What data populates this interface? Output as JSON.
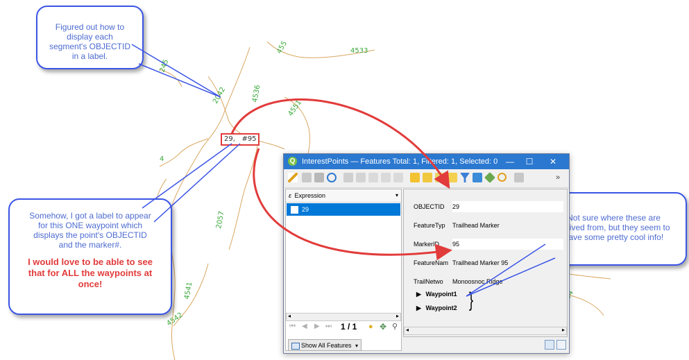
{
  "callouts": {
    "top": "Figured out how to display each segment's OBJECTID in a label.",
    "left_main": "Somehow, I got a label to appear for this ONE waypoint which displays the point's OBJECTID and the marker#.",
    "left_red": "I would love to be able to see that for ALL the waypoints at once!",
    "right": "Not sure where these are derived from, but they seem to have some pretty cool info!"
  },
  "map": {
    "waypoint_label": "29,   #95",
    "segment_labels": [
      "2042",
      "4536",
      "4551",
      "2057",
      "4541",
      "4542",
      "4533",
      "455",
      "245",
      "4",
      "94"
    ],
    "colors": {
      "trail": "#d9a760",
      "label": "#3aa83a",
      "annotation": "#e23b3b",
      "callout_border": "#3b55e6"
    }
  },
  "window": {
    "title": "InterestPoints — Features Total: 1, Filtered: 1, Selected: 0",
    "controls": [
      "minimize-icon",
      "maximize-icon",
      "close-icon"
    ],
    "expression_label": "Expression",
    "list": [
      {
        "value": "29"
      }
    ],
    "fields": [
      {
        "name": "OBJECTID",
        "value": "29"
      },
      {
        "name": "FeatureTyp",
        "value": "Trailhead Marker"
      },
      {
        "name": "MarkerID",
        "value": "95"
      },
      {
        "name": "FeatureNam",
        "value": "Trailhead Marker 95"
      },
      {
        "name": "TrailNetwo",
        "value": "Monoosnoc Ridge"
      }
    ],
    "relations": [
      "Waypoint1",
      "Waypoint2"
    ],
    "nav_page": "1 / 1",
    "show_all": "Show All Features",
    "accent": "#2b78d0"
  }
}
